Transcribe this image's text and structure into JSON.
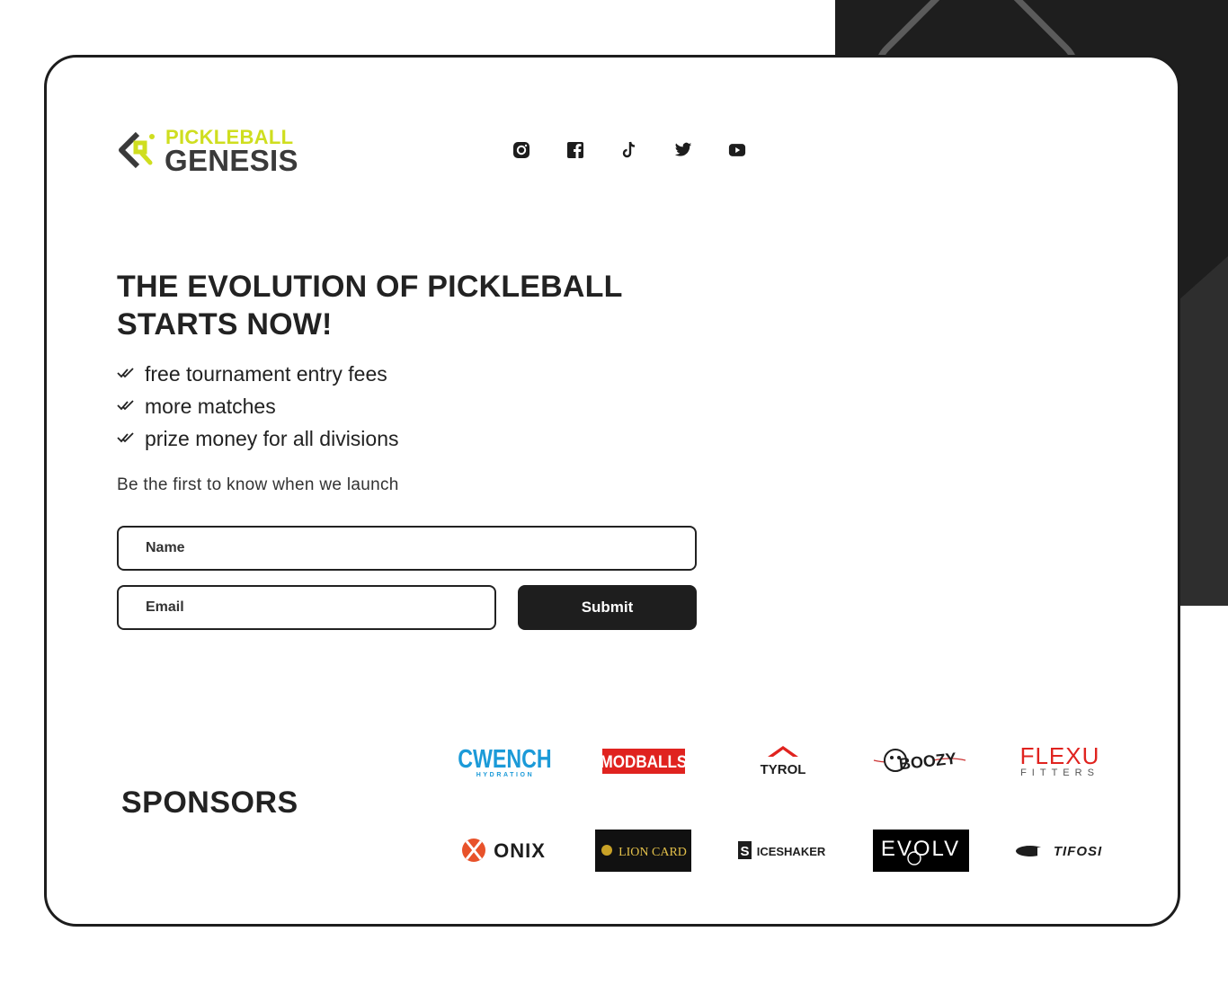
{
  "brand": {
    "line1": "PICKLEBALL",
    "line2": "GENESIS",
    "accent": "#cfde1f"
  },
  "socials": [
    {
      "icon": "instagram-icon"
    },
    {
      "icon": "facebook-icon"
    },
    {
      "icon": "tiktok-icon"
    },
    {
      "icon": "twitter-icon"
    },
    {
      "icon": "youtube-icon"
    }
  ],
  "hero": {
    "headline": "THE EVOLUTION OF PICKLEBALL STARTS NOW!",
    "features": [
      "free tournament entry fees",
      "more matches",
      "prize money for all divisions"
    ],
    "tagline": "Be the first to know when we launch"
  },
  "form": {
    "name_placeholder": "Name",
    "email_placeholder": "Email",
    "submit_label": "Submit"
  },
  "sponsors": {
    "title": "SPONSORS",
    "items": [
      {
        "name": "CWENCH",
        "sub": "HYDRATION"
      },
      {
        "name": "MODBALLS"
      },
      {
        "name": "TYROL"
      },
      {
        "name": "BOOZY"
      },
      {
        "name": "FLEXU",
        "sub": "FITTERS"
      },
      {
        "name": "ONIX"
      },
      {
        "name": "LION CARD"
      },
      {
        "name": "ICESHAKER"
      },
      {
        "name": "EVOLV"
      },
      {
        "name": "TIFOSI"
      }
    ]
  },
  "colors": {
    "dark": "#1e1e1e",
    "text": "#222222"
  }
}
